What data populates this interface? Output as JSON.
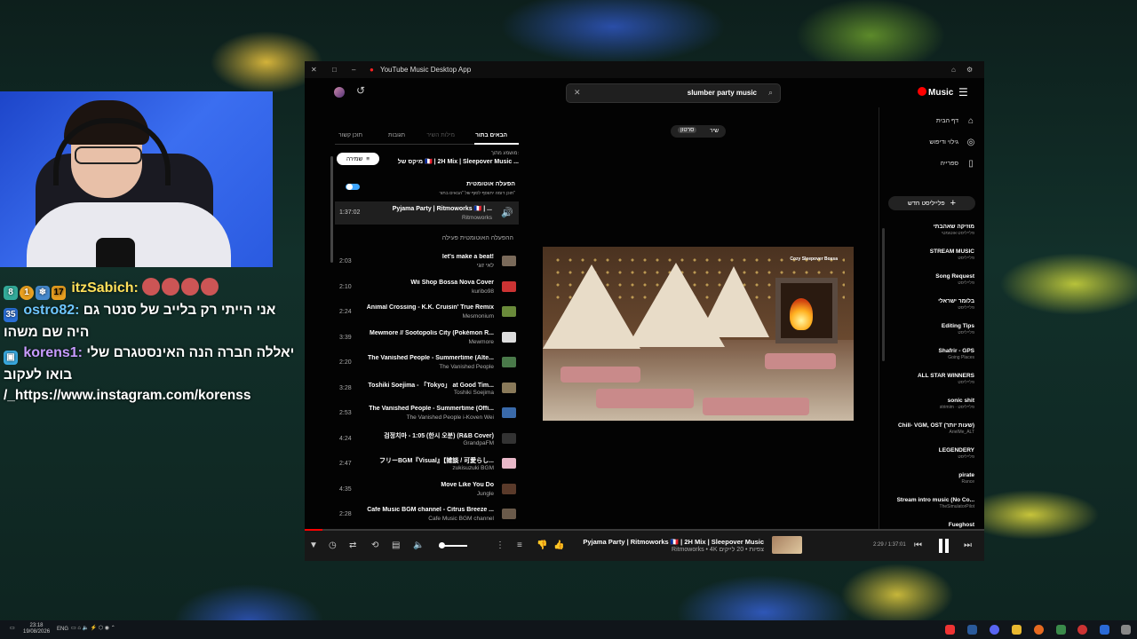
{
  "chat": {
    "messages": [
      {
        "badges": [
          "8",
          "1",
          "17"
        ],
        "name": "itzSabich:",
        "name_color": "#ffe05a",
        "emotes": 4,
        "text": ""
      },
      {
        "badges": [
          "35"
        ],
        "name": "ostro82:",
        "name_color": "#6ec6ff",
        "text": "אני הייתי רק בלייב של סנטר גם היה שם משהו"
      },
      {
        "badges": [
          "cube"
        ],
        "name": "korens1:",
        "name_color": "#c79bff",
        "text": "יאללה חברה הנה האינסטגרם שלי בואו לעקוב /_https://www.instagram.com/korenss"
      }
    ]
  },
  "window": {
    "title": "YouTube Music Desktop App",
    "search_value": "slumber party music",
    "logo_text": "Music"
  },
  "sidebar": {
    "nav": [
      {
        "label": "דף הבית",
        "icon": "home-icon"
      },
      {
        "label": "גילוי ודיפוש",
        "icon": "explore-icon"
      },
      {
        "label": "ספרייה",
        "icon": "library-icon"
      }
    ],
    "new_playlist": "פלייליסט חדש",
    "playlists": [
      {
        "title": "מוזיקה שאהבתי",
        "sub": "פלייליסט אוטומטי"
      },
      {
        "title": "STREAM MUSIC",
        "sub": "פלייליסט"
      },
      {
        "title": "Song Request",
        "sub": "פלייליסט"
      },
      {
        "title": "בלומר ישראלי",
        "sub": "פלייליסט"
      },
      {
        "title": "Editing Tips",
        "sub": "פלייליסט"
      },
      {
        "title": "Shafrir - GPS",
        "sub": "Going Places"
      },
      {
        "title": "ALL STAR WINNERS",
        "sub": "פלייליסט"
      },
      {
        "title": "sonic shit",
        "sub": "strimim · פלייליסט"
      },
      {
        "title": "Chill- VGM, OST (שעות יותר)",
        "sub": "ArielMe_ALT"
      },
      {
        "title": "LEGENDERY",
        "sub": "פלייליסט"
      },
      {
        "title": "pirate",
        "sub": "Rance"
      },
      {
        "title": "Stream intro music (No Co...",
        "sub": "TheSimulatorPilot"
      },
      {
        "title": "Fueghost",
        "sub": ""
      }
    ]
  },
  "queue": {
    "tabs": [
      "הבאים בתור",
      "מילות השיר",
      "תגובות",
      "תוכן קשור"
    ],
    "source_label": "מושמע מתוך:",
    "source_title": "מיקס של 🇫🇷 | 2H Mix | Sleepover Music ...",
    "save_chip": "שמירה",
    "autoplay_title": "הפעלה אוטומטית",
    "autoplay_sub": "תוכן דומה יתווסף לסוף של \"הבאים בתור\"",
    "now_playing": {
      "duration": "1:37:02",
      "title": "Pyjama Party | Ritmoworks 🇫🇷 | ...",
      "artist": "Ritmoworks"
    },
    "autoplay_header": "ההפעלה האוטומטית פעילה",
    "items": [
      {
        "duration": "2:03",
        "title": "let's make a beat!",
        "artist": "לאי זוגי",
        "color": "#7a6a5a"
      },
      {
        "duration": "2:10",
        "title": "Wii Shop Bossa Nova Cover",
        "artist": "kuribo98",
        "color": "#c33"
      },
      {
        "duration": "2:24",
        "title": "Animal Crossing - K.K. Cruisin' True Remix",
        "artist": "Mesmonium",
        "color": "#6a8a3a"
      },
      {
        "duration": "3:39",
        "title": "Mewmore // Sootopolis City (Pokémon R...",
        "artist": "Mewmore",
        "color": "#ddd"
      },
      {
        "duration": "2:20",
        "title": "The Vanished People - Summertime (Alte...",
        "artist": "The Vanished People",
        "color": "#4a7a4a"
      },
      {
        "duration": "3:28",
        "title": "Toshiki Soejima - 「Tokyo」 at Good Tim...",
        "artist": "Toshiki Soejima",
        "color": "#8a7a5a"
      },
      {
        "duration": "2:53",
        "title": "The Vanished People - Summertime (Offi...",
        "artist": "The Vanished People i-Koven Wei",
        "color": "#3a6aaa"
      },
      {
        "duration": "4:24",
        "title": "검정치마 - 1:05 (한시 오분) (R&B Cover)",
        "artist": "GrandpaFM",
        "color": "#333"
      },
      {
        "duration": "2:47",
        "title": "フリーBGM『Visual』【雑談 / 可愛らし...",
        "artist": "zukisuzuki BGM",
        "color": "#e8b8c8"
      },
      {
        "duration": "4:35",
        "title": "Move Like You Do",
        "artist": "Jungle",
        "color": "#5a3a2a"
      },
      {
        "duration": "2:28",
        "title": "Cafe Music BGM channel - Citrus Breeze ...",
        "artist": "Cafe Music BGM channel",
        "color": "#6a5a4a"
      }
    ]
  },
  "player": {
    "toggle": [
      "שיר",
      "סרטון"
    ],
    "video_caption": "Cozy Sleepover Bossa",
    "track_title": "Pyjama Party | Ritmoworks 🇫🇷 | 2H Mix | Sleepover Music",
    "track_sub": "Ritmoworks • 4K צפיות • 20 לייקים",
    "time": "2:29 / 1:37:01",
    "progress": 0.026,
    "volume": 0.3
  },
  "taskbar": {
    "time": "23:18",
    "date": "19/08/2026",
    "lang": "ENG"
  }
}
